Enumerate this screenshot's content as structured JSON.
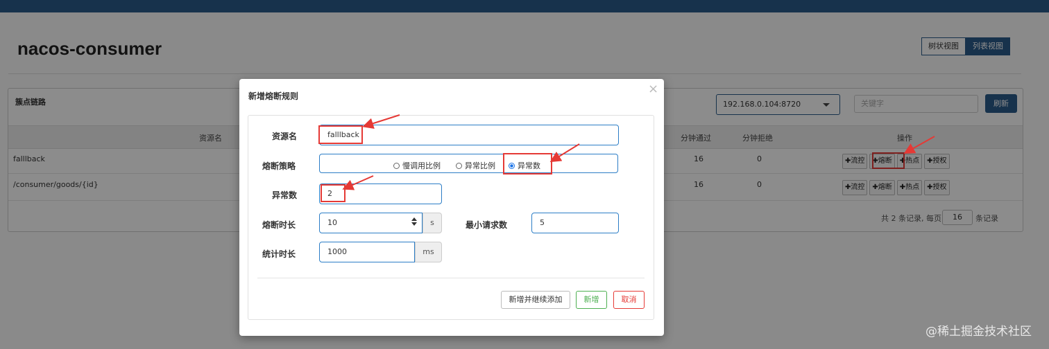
{
  "app": {
    "title": "nacos-consumer",
    "view_toggle": [
      "树状视图",
      "列表视图"
    ],
    "watermark": "@稀土掘金技术社区"
  },
  "panel": {
    "title": "簇点链路",
    "machine": "192.168.0.104:8720",
    "keyword_placeholder": "关键字",
    "refresh": "刷新",
    "columns": {
      "resource": "资源名",
      "pass_minute": "分钟通过",
      "reject_minute": "分钟拒绝",
      "ops": "操作"
    },
    "rows": [
      {
        "resource": "falllback",
        "pass_minute": "16",
        "reject_minute": "0"
      },
      {
        "resource": "/consumer/goods/{id}",
        "pass_minute": "16",
        "reject_minute": "0"
      }
    ],
    "op_buttons": [
      "流控",
      "熔断",
      "热点",
      "授权"
    ],
    "pager": {
      "prefix": "共 2 条记录, 每页",
      "page_size": "16",
      "suffix": "条记录"
    }
  },
  "modal": {
    "title": "新增熔断规则",
    "close": "×",
    "fields": {
      "resource_label": "资源名",
      "resource_value": "falllback",
      "strategy_label": "熔断策略",
      "strategy_options": [
        "慢调用比例",
        "异常比例",
        "异常数"
      ],
      "strategy_selected": "异常数",
      "exception_count_label": "异常数",
      "exception_count_value": "2",
      "duration_label": "熔断时长",
      "duration_value": "10",
      "duration_unit": "s",
      "min_request_label": "最小请求数",
      "min_request_value": "5",
      "stat_label": "统计时长",
      "stat_value": "1000",
      "stat_unit": "ms"
    },
    "buttons": {
      "add_continue": "新增并继续添加",
      "add": "新增",
      "cancel": "取消"
    }
  },
  "colors": {
    "brand": "#2b5c8a",
    "annotation": "#e53935",
    "add_button": "#4caf50",
    "cancel_button": "#e53935"
  }
}
